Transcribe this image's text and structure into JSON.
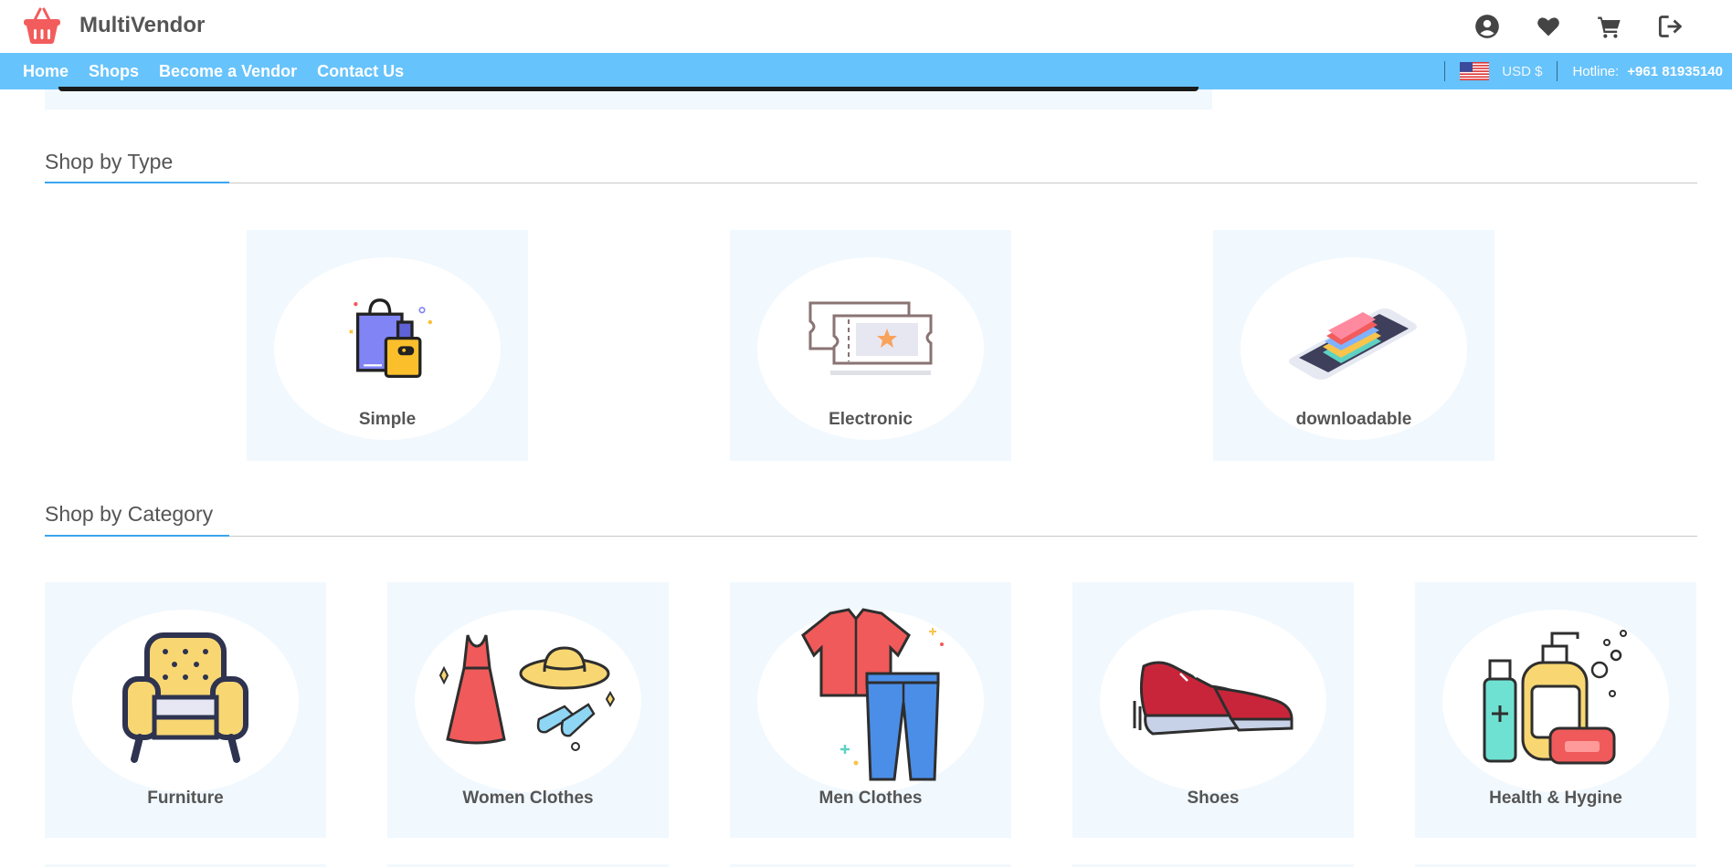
{
  "brand": {
    "name": "MultiVendor",
    "logo": "basket-logo"
  },
  "header_icons": [
    {
      "name": "account-icon"
    },
    {
      "name": "wishlist-icon"
    },
    {
      "name": "cart-icon"
    },
    {
      "name": "logout-icon"
    }
  ],
  "nav": {
    "links": [
      "Home",
      "Shops",
      "Become a Vendor",
      "Contact Us"
    ],
    "currency": "USD $",
    "hotline_label": "Hotline:",
    "hotline_number": "+961 81935140"
  },
  "sections": {
    "type": {
      "title": "Shop by Type",
      "items": [
        {
          "label": "Simple",
          "icon": "shopping-bags-icon"
        },
        {
          "label": "Electronic",
          "icon": "tickets-icon"
        },
        {
          "label": "downloadable",
          "icon": "phone-books-icon"
        }
      ]
    },
    "category": {
      "title": "Shop by Category",
      "items": [
        {
          "label": "Furniture",
          "icon": "armchair-icon"
        },
        {
          "label": "Women Clothes",
          "icon": "dress-hat-icon"
        },
        {
          "label": "Men Clothes",
          "icon": "shirt-pants-icon"
        },
        {
          "label": "Shoes",
          "icon": "sneakers-icon"
        },
        {
          "label": "Health & Hygine",
          "icon": "soap-bottles-icon"
        }
      ]
    }
  },
  "colors": {
    "navbar": "#67c3fb",
    "card_bg": "#f1f8fe",
    "accent": "#3aa6ee",
    "logo": "#f25c5c"
  }
}
